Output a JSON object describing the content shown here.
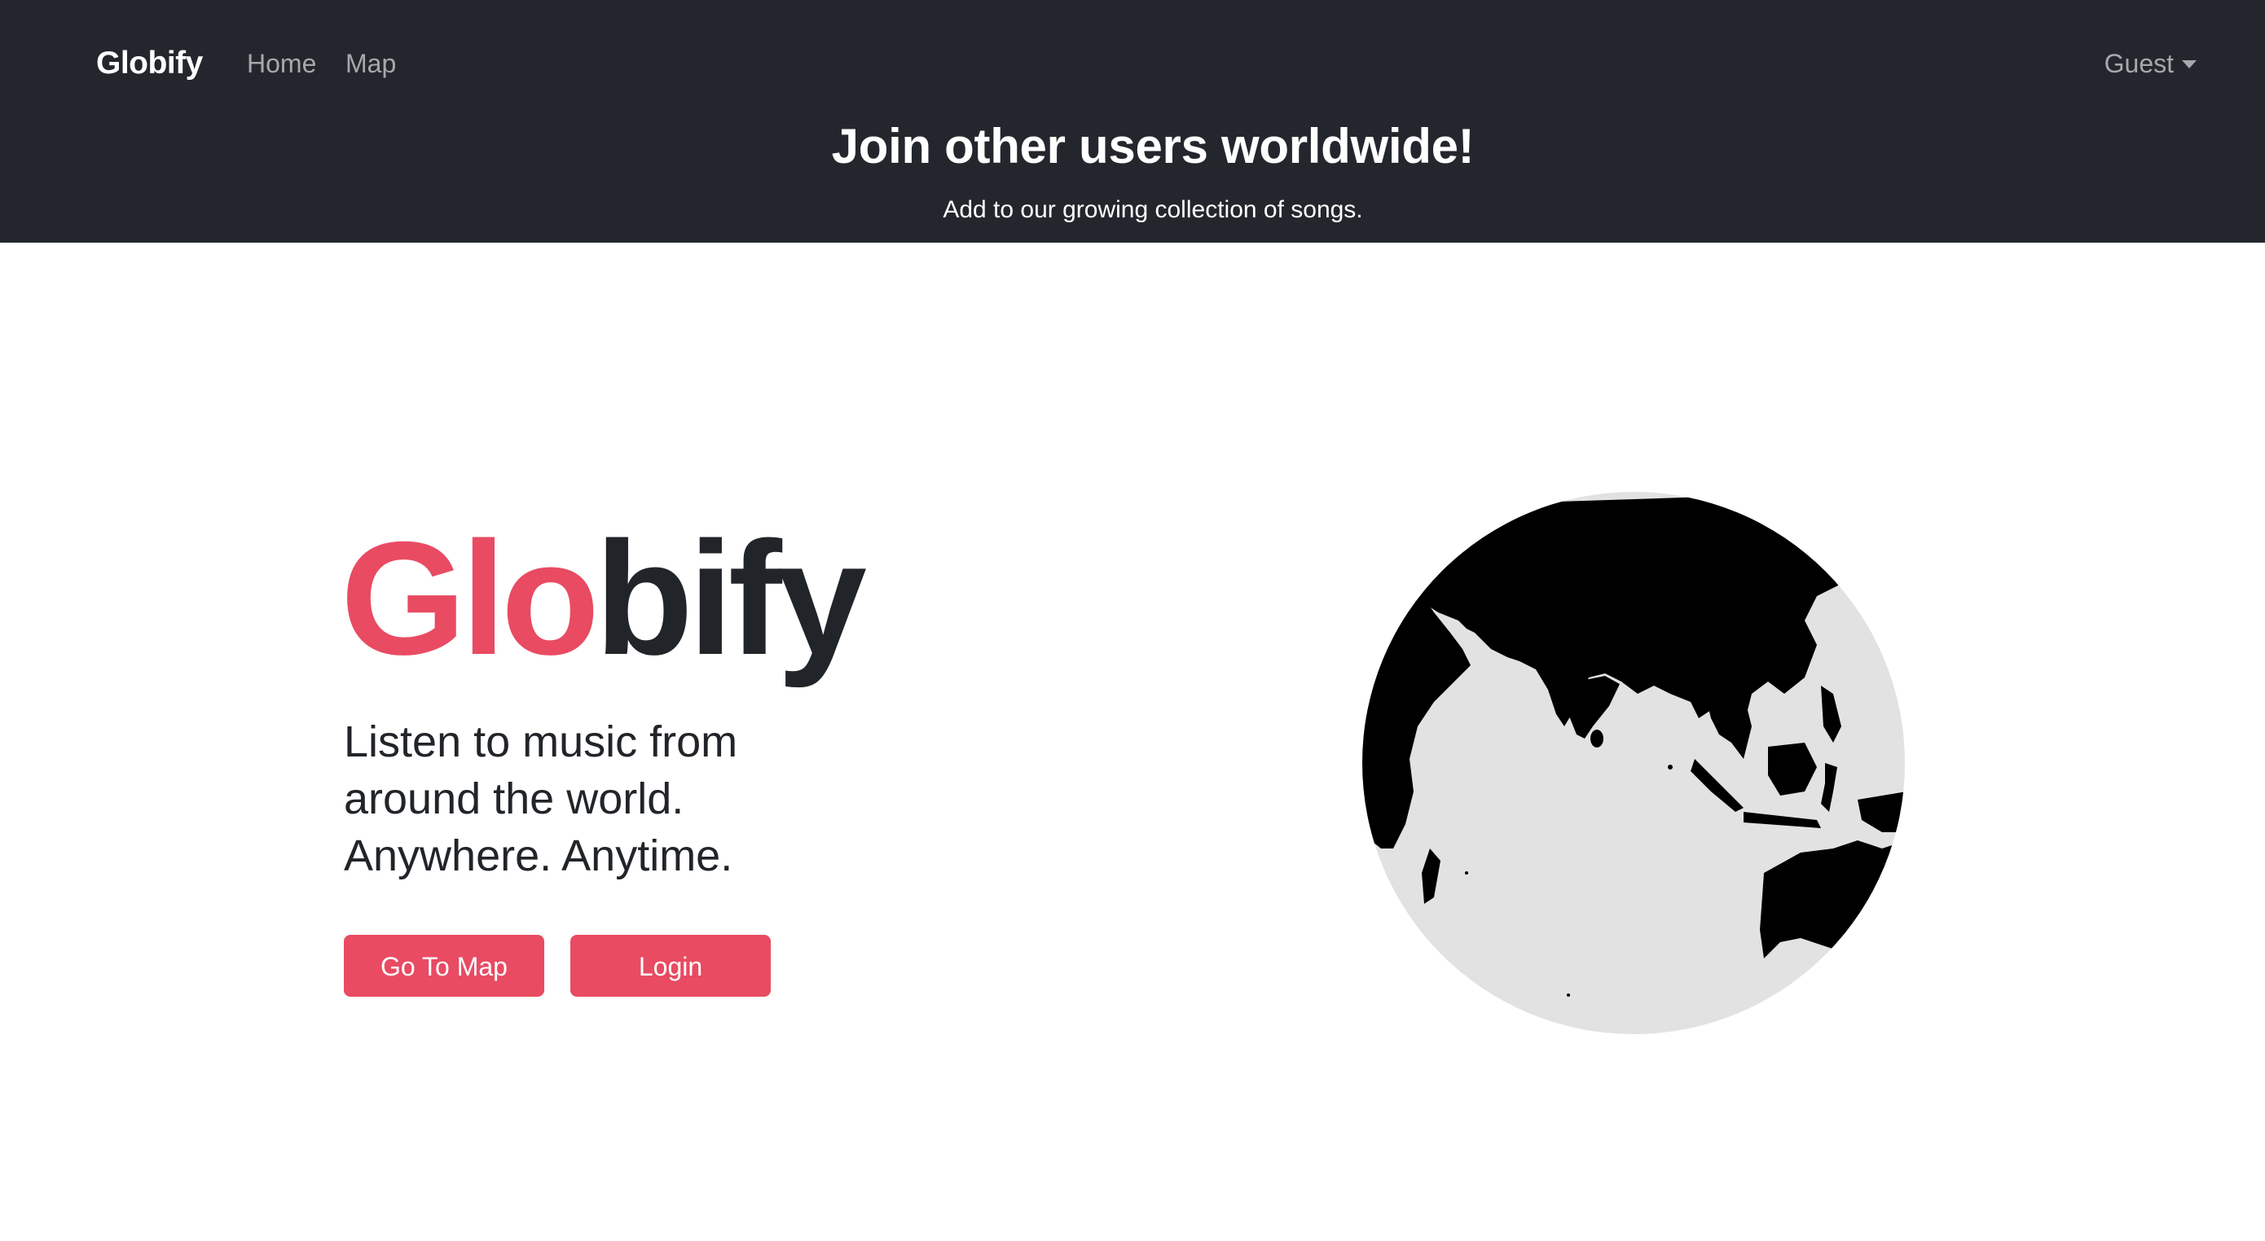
{
  "navbar": {
    "brand": "Globify",
    "links": [
      {
        "label": "Home"
      },
      {
        "label": "Map"
      }
    ],
    "user_menu_label": "Guest"
  },
  "header": {
    "title": "Join other users worldwide!",
    "subtitle": "Add to our growing collection of songs."
  },
  "hero": {
    "logo_part1": "Glo",
    "logo_part2": "bify",
    "tagline_lines": [
      "Listen to music from",
      "around the world.",
      "Anywhere. Anytime."
    ],
    "buttons": {
      "map": "Go To Map",
      "login": "Login"
    }
  },
  "colors": {
    "accent": "#e84b62",
    "header_bg": "#23272d",
    "globe_ocean": "#e2e2e2",
    "globe_land": "#000000"
  },
  "icons": {
    "user_menu": "caret-down-icon",
    "globe": "globe-icon"
  }
}
